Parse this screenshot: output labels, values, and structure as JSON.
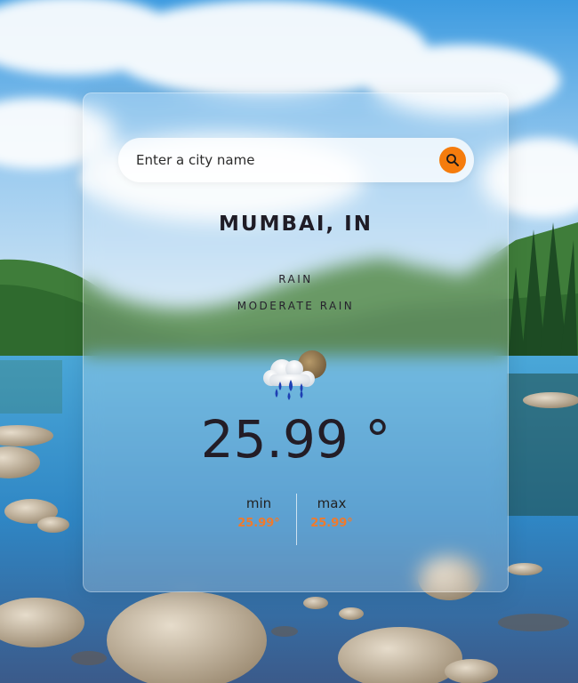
{
  "search": {
    "placeholder": "Enter a city name",
    "button_icon": "search-icon"
  },
  "location": {
    "city": "MUMBAI, IN"
  },
  "weather": {
    "main": "RAIN",
    "description": "MODERATE RAIN",
    "icon": "cloud-rain-moon-icon",
    "temperature": "25.99 °"
  },
  "min": {
    "label": "min",
    "value": "25.99°"
  },
  "max": {
    "label": "max",
    "value": "25.99°"
  },
  "colors": {
    "accent": "#f57c0d",
    "minmax_value": "#f07a2c",
    "text_dark": "#231d26"
  }
}
